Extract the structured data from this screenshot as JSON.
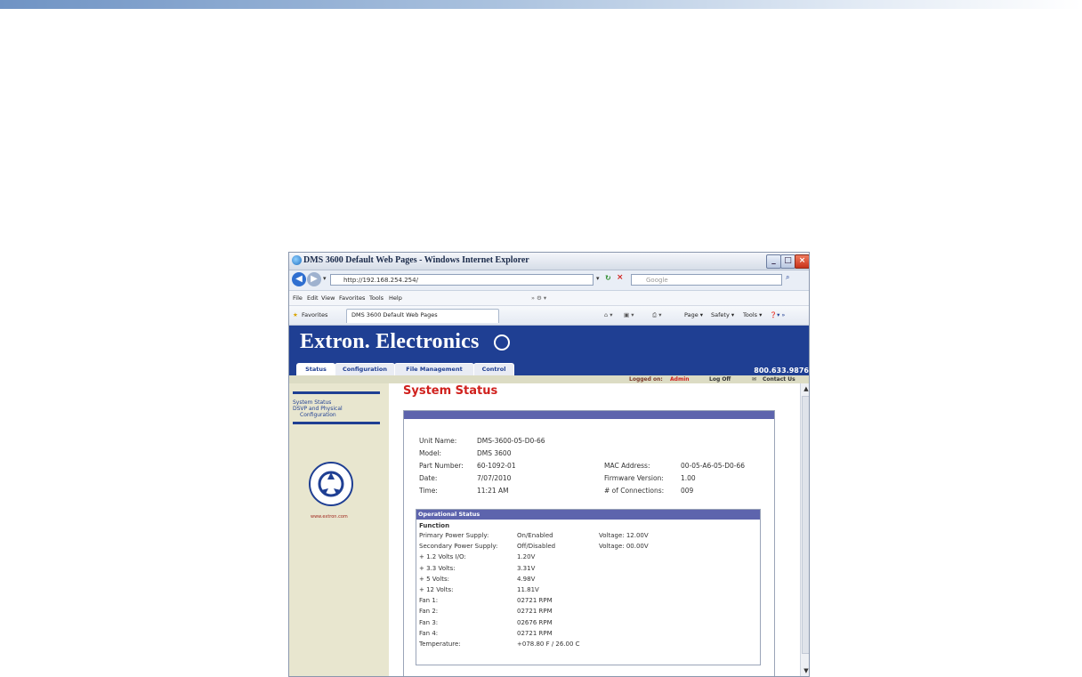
{
  "window": {
    "title": "DMS 3600 Default Web Pages - Windows Internet Explorer",
    "address": "http://192.168.254.254/",
    "search_placeholder": "Google"
  },
  "menubar": [
    "File",
    "Edit",
    "View",
    "Favorites",
    "Tools",
    "Help"
  ],
  "favbar": {
    "favorites_label": "Favorites",
    "tab_label": "DMS 3600 Default Web Pages",
    "commands": [
      "Page ▾",
      "Safety ▾",
      "Tools ▾"
    ]
  },
  "site": {
    "brand": "Extron. Electronics",
    "tabs": [
      "Status",
      "Configuration",
      "File Management",
      "Control"
    ],
    "phone": "800.633.9876",
    "logged_on_label": "Logged on:",
    "logged_on_user": "Admin",
    "log_off": "Log Off",
    "contact_us": "Contact Us"
  },
  "sidebar": {
    "links": [
      "System Status",
      "DSVP and Physical",
      "Configuration"
    ],
    "url": "www.extron.com"
  },
  "main": {
    "title": "System Status",
    "unit": [
      {
        "label": "Unit Name:",
        "value": "DMS-3600-05-D0-66"
      },
      {
        "label": "Model:",
        "value": "DMS 3600"
      },
      {
        "label": "Part Number:",
        "value": "60-1092-01"
      },
      {
        "label": "Date:",
        "value": "7/07/2010"
      },
      {
        "label": "Time:",
        "value": "11:21 AM"
      }
    ],
    "unit_right": [
      {
        "label": "MAC Address:",
        "value": "00-05-A6-05-D0-66"
      },
      {
        "label": "Firmware Version:",
        "value": "1.00"
      },
      {
        "label": "# of Connections:",
        "value": "009"
      }
    ],
    "operational": {
      "title": "Operational Status",
      "header": "Function",
      "rows": [
        {
          "label": "Primary Power Supply:",
          "value": "On/Enabled",
          "extra": "Voltage:  12.00V"
        },
        {
          "label": "Secondary Power Supply:",
          "value": "Off/Disabled",
          "extra": "Voltage:  00.00V"
        },
        {
          "label": "+ 1.2 Volts I/O:",
          "value": "1.20V",
          "extra": ""
        },
        {
          "label": "+ 3.3 Volts:",
          "value": "3.31V",
          "extra": ""
        },
        {
          "label": "+ 5 Volts:",
          "value": "4.98V",
          "extra": ""
        },
        {
          "label": "+ 12 Volts:",
          "value": "11.81V",
          "extra": ""
        },
        {
          "label": "Fan 1:",
          "value": "02721 RPM",
          "extra": ""
        },
        {
          "label": "Fan 2:",
          "value": "02721 RPM",
          "extra": ""
        },
        {
          "label": "Fan 3:",
          "value": "02676 RPM",
          "extra": ""
        },
        {
          "label": "Fan 4:",
          "value": "02721 RPM",
          "extra": ""
        },
        {
          "label": "Temperature:",
          "value": "+078.80 F / 26.00 C",
          "extra": ""
        }
      ]
    }
  },
  "colors": {
    "banner": "#1f3f93",
    "title_red": "#d0211d",
    "section_header": "#5d64ad",
    "sidebar_bg": "#e8e6cf"
  }
}
